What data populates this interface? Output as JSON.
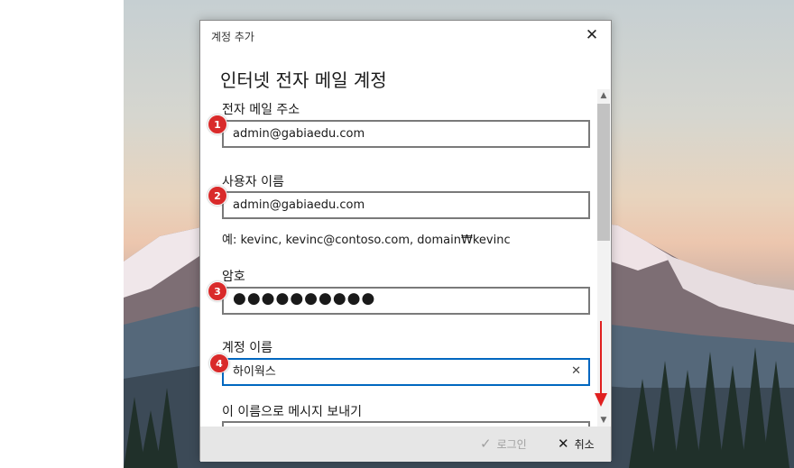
{
  "dialog": {
    "title": "계정 추가",
    "heading": "인터넷 전자 메일 계정"
  },
  "fields": {
    "email": {
      "label": "전자 메일 주소",
      "value": "admin@gabiaedu.com",
      "badge": "1"
    },
    "username": {
      "label": "사용자 이름",
      "value": "admin@gabiaedu.com",
      "badge": "2"
    },
    "username_hint": "예: kevinc, kevinc@contoso.com, domain₩kevinc",
    "password": {
      "label": "암호",
      "value": "●●●●●●●●●●",
      "badge": "3"
    },
    "account_name": {
      "label": "계정 이름",
      "value": "하이웍스",
      "badge": "4"
    },
    "send_name": {
      "label": "이 이름으로 메시지 보내기"
    }
  },
  "footer": {
    "login_label": "로그인",
    "cancel_label": "취소"
  },
  "icons": {
    "close": "close-icon",
    "clear": "clear-icon",
    "check": "check-icon"
  },
  "colors": {
    "badge": "#d92a2a",
    "focus_border": "#0067c0",
    "annotation_arrow": "#e02020"
  }
}
